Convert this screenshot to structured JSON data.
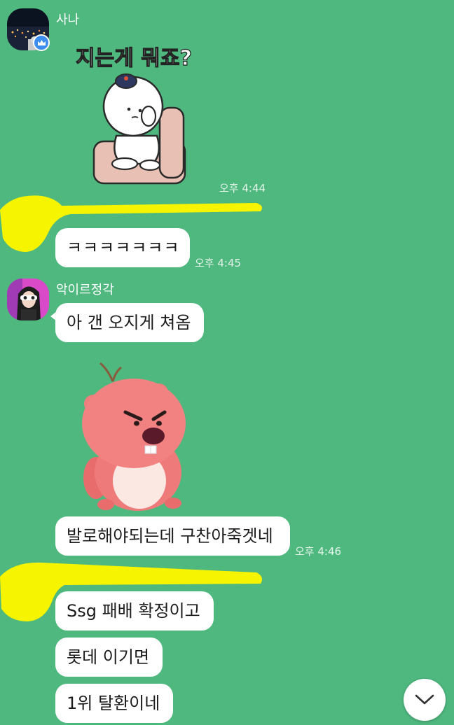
{
  "chat": {
    "sender1": {
      "name": "사나",
      "avatar_icon": "night-city-avatar",
      "badge_icon": "crown-badge-icon"
    },
    "sender1_text": "지는게 뭐죠?",
    "sticker1": "bald-character-armchair-sticker",
    "time1": "오후 4:44",
    "msg_kkk": "ㅋㅋㅋㅋㅋㅋㅋ",
    "time2": "오후 4:45",
    "sender2": {
      "name": "악이르정각",
      "avatar_icon": "girl-avatar"
    },
    "msg_a": "아 갠 오지게 쳐옴",
    "sticker2": "pink-beaver-loopy-sticker",
    "msg_valorant": "발로해야되는데 구찬아죽겟네",
    "time3": "오후 4:46",
    "msg_ssg": "Ssg 패배 확정이고",
    "msg_lotte": "롯데 이기면",
    "msg_first": "1위 탈환이네"
  },
  "controls": {
    "scroll_down_icon": "chevron-down-icon"
  },
  "colors": {
    "chat_background": "#4fb87f",
    "bubble": "#ffffff",
    "highlighter": "#f7f400"
  }
}
